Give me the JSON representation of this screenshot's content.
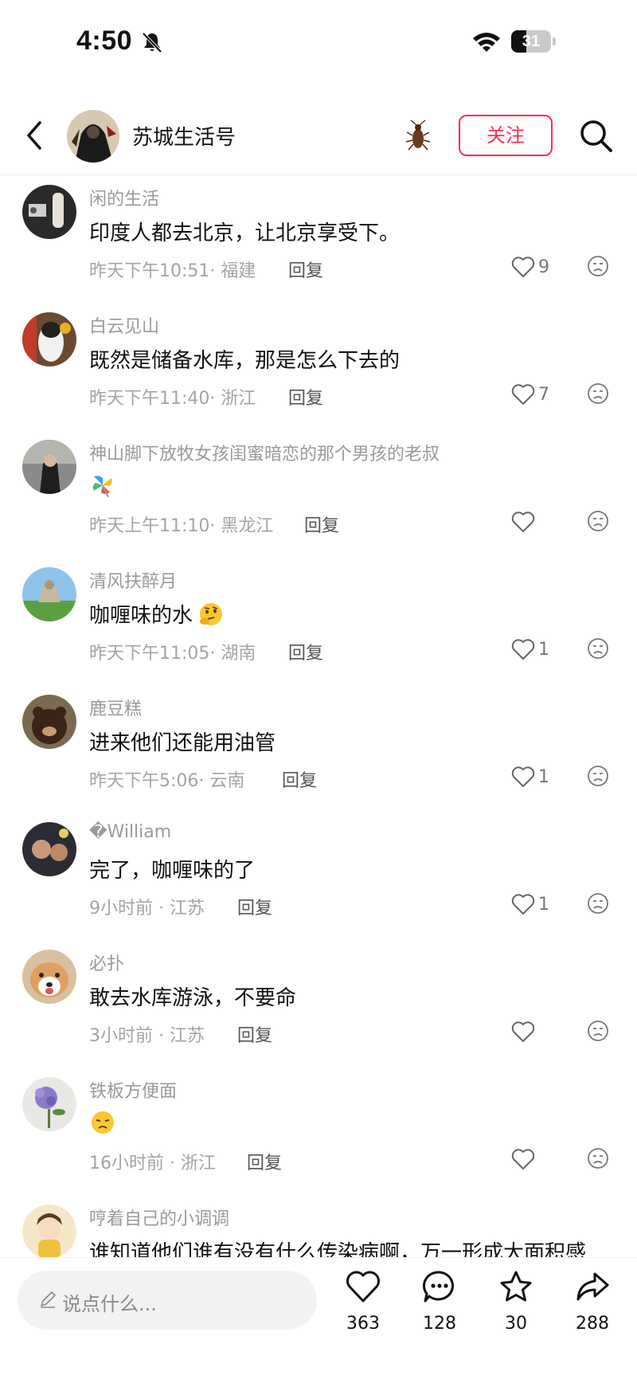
{
  "status_bar": {
    "time": "4:50",
    "battery_level": "31"
  },
  "header": {
    "channel_name": "苏城生活号",
    "follow_label": "关注"
  },
  "comments": [
    {
      "username": "闲的生活",
      "text": "印度人都去北京，让北京享受下。",
      "time_location": "昨天下午10:51· 福建",
      "reply": "回复",
      "likes": "9",
      "emoji": ""
    },
    {
      "username": "白云见山",
      "text": "既然是储备水库，那是怎么下去的",
      "time_location": "昨天下午11:40· 浙江",
      "reply": "回复",
      "likes": "7",
      "emoji": ""
    },
    {
      "username": "神山脚下放牧女孩闺蜜暗恋的那个男孩的老叔",
      "text": "",
      "time_location": "昨天上午11:10· 黑龙江",
      "reply": "回复",
      "likes": "",
      "emoji": "pinwheel-emoji"
    },
    {
      "username": "清风扶醉月",
      "text": "咖喱味的水",
      "time_location": "昨天下午11:05· 湖南",
      "reply": "回复",
      "likes": "1",
      "emoji": "thinking-face-emoji"
    },
    {
      "username": "鹿豆糕",
      "text": "进来他们还能用油管",
      "time_location": "昨天下午5:06· 云南",
      "reply": "回复",
      "likes": "1",
      "emoji": ""
    },
    {
      "username": "�William",
      "text": "完了，咖喱味的了",
      "time_location": "9小时前 · 江苏",
      "reply": "回复",
      "likes": "1",
      "emoji": ""
    },
    {
      "username": "必扑",
      "text": "敢去水库游泳，不要命",
      "time_location": "3小时前 · 江苏",
      "reply": "回复",
      "likes": "",
      "emoji": ""
    },
    {
      "username": "铁板方便面",
      "text": "",
      "time_location": "16小时前 · 浙江",
      "reply": "回复",
      "likes": "",
      "emoji": "unamused-face-emoji"
    },
    {
      "username": "哼着自己的小调调",
      "text": "谁知道他们谁有没有什么传染病啊，万一形成大面积感",
      "time_location": "",
      "reply": "",
      "likes": "",
      "emoji": ""
    }
  ],
  "bottom_bar": {
    "input_placeholder": "说点什么...",
    "likes": "363",
    "comments": "128",
    "favorites": "30",
    "shares": "288"
  },
  "colors": {
    "accent": "#fe2c55",
    "secondary_text": "#9a9a9a"
  },
  "icons": [
    "bell-muted-icon",
    "wifi-icon",
    "battery-icon",
    "back-icon",
    "bug-icon",
    "search-icon",
    "heart-icon",
    "dislike-icon",
    "pencil-icon",
    "comment-icon",
    "star-icon",
    "share-icon"
  ]
}
